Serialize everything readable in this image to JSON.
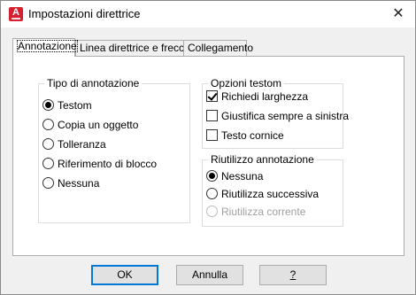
{
  "window": {
    "title": "Impostazioni direttrice"
  },
  "tabs": [
    {
      "label": "Annotazione"
    },
    {
      "label": "Linea direttrice e freccia"
    },
    {
      "label": "Collegamento"
    }
  ],
  "annotation_type": {
    "title": "Tipo di annotazione",
    "options": [
      {
        "label": "Testom",
        "selected": true
      },
      {
        "label": "Copia un oggetto",
        "selected": false
      },
      {
        "label": "Tolleranza",
        "selected": false
      },
      {
        "label": "Riferimento di blocco",
        "selected": false
      },
      {
        "label": "Nessuna",
        "selected": false
      }
    ]
  },
  "mtext_options": {
    "title": "Opzioni testom",
    "checkboxes": [
      {
        "label": "Richiedi larghezza",
        "checked": true
      },
      {
        "label": "Giustifica sempre a sinistra",
        "checked": false
      },
      {
        "label": "Testo cornice",
        "checked": false
      }
    ]
  },
  "annotation_reuse": {
    "title": "Riutilizzo annotazione",
    "options": [
      {
        "label": "Nessuna",
        "selected": true,
        "enabled": true
      },
      {
        "label": "Riutilizza successiva",
        "selected": false,
        "enabled": true
      },
      {
        "label": "Riutilizza corrente",
        "selected": false,
        "enabled": false
      }
    ]
  },
  "buttons": {
    "ok": "OK",
    "cancel": "Annulla",
    "help": "?"
  }
}
